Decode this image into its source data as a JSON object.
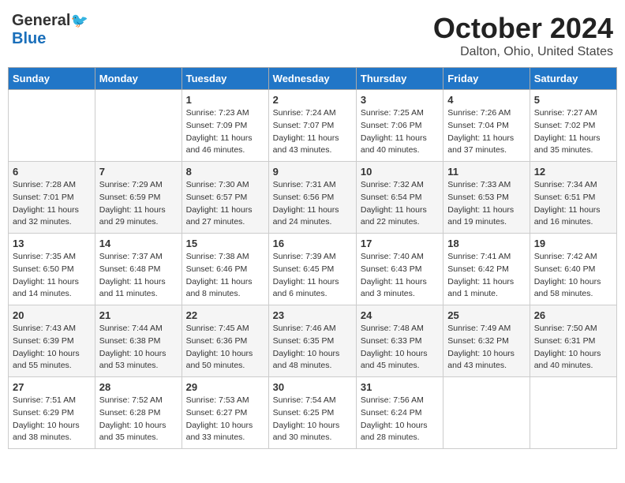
{
  "header": {
    "logo_general": "General",
    "logo_blue": "Blue",
    "month": "October 2024",
    "location": "Dalton, Ohio, United States"
  },
  "days_of_week": [
    "Sunday",
    "Monday",
    "Tuesday",
    "Wednesday",
    "Thursday",
    "Friday",
    "Saturday"
  ],
  "weeks": [
    [
      {
        "day": "",
        "info": ""
      },
      {
        "day": "",
        "info": ""
      },
      {
        "day": "1",
        "info": "Sunrise: 7:23 AM\nSunset: 7:09 PM\nDaylight: 11 hours and 46 minutes."
      },
      {
        "day": "2",
        "info": "Sunrise: 7:24 AM\nSunset: 7:07 PM\nDaylight: 11 hours and 43 minutes."
      },
      {
        "day": "3",
        "info": "Sunrise: 7:25 AM\nSunset: 7:06 PM\nDaylight: 11 hours and 40 minutes."
      },
      {
        "day": "4",
        "info": "Sunrise: 7:26 AM\nSunset: 7:04 PM\nDaylight: 11 hours and 37 minutes."
      },
      {
        "day": "5",
        "info": "Sunrise: 7:27 AM\nSunset: 7:02 PM\nDaylight: 11 hours and 35 minutes."
      }
    ],
    [
      {
        "day": "6",
        "info": "Sunrise: 7:28 AM\nSunset: 7:01 PM\nDaylight: 11 hours and 32 minutes."
      },
      {
        "day": "7",
        "info": "Sunrise: 7:29 AM\nSunset: 6:59 PM\nDaylight: 11 hours and 29 minutes."
      },
      {
        "day": "8",
        "info": "Sunrise: 7:30 AM\nSunset: 6:57 PM\nDaylight: 11 hours and 27 minutes."
      },
      {
        "day": "9",
        "info": "Sunrise: 7:31 AM\nSunset: 6:56 PM\nDaylight: 11 hours and 24 minutes."
      },
      {
        "day": "10",
        "info": "Sunrise: 7:32 AM\nSunset: 6:54 PM\nDaylight: 11 hours and 22 minutes."
      },
      {
        "day": "11",
        "info": "Sunrise: 7:33 AM\nSunset: 6:53 PM\nDaylight: 11 hours and 19 minutes."
      },
      {
        "day": "12",
        "info": "Sunrise: 7:34 AM\nSunset: 6:51 PM\nDaylight: 11 hours and 16 minutes."
      }
    ],
    [
      {
        "day": "13",
        "info": "Sunrise: 7:35 AM\nSunset: 6:50 PM\nDaylight: 11 hours and 14 minutes."
      },
      {
        "day": "14",
        "info": "Sunrise: 7:37 AM\nSunset: 6:48 PM\nDaylight: 11 hours and 11 minutes."
      },
      {
        "day": "15",
        "info": "Sunrise: 7:38 AM\nSunset: 6:46 PM\nDaylight: 11 hours and 8 minutes."
      },
      {
        "day": "16",
        "info": "Sunrise: 7:39 AM\nSunset: 6:45 PM\nDaylight: 11 hours and 6 minutes."
      },
      {
        "day": "17",
        "info": "Sunrise: 7:40 AM\nSunset: 6:43 PM\nDaylight: 11 hours and 3 minutes."
      },
      {
        "day": "18",
        "info": "Sunrise: 7:41 AM\nSunset: 6:42 PM\nDaylight: 11 hours and 1 minute."
      },
      {
        "day": "19",
        "info": "Sunrise: 7:42 AM\nSunset: 6:40 PM\nDaylight: 10 hours and 58 minutes."
      }
    ],
    [
      {
        "day": "20",
        "info": "Sunrise: 7:43 AM\nSunset: 6:39 PM\nDaylight: 10 hours and 55 minutes."
      },
      {
        "day": "21",
        "info": "Sunrise: 7:44 AM\nSunset: 6:38 PM\nDaylight: 10 hours and 53 minutes."
      },
      {
        "day": "22",
        "info": "Sunrise: 7:45 AM\nSunset: 6:36 PM\nDaylight: 10 hours and 50 minutes."
      },
      {
        "day": "23",
        "info": "Sunrise: 7:46 AM\nSunset: 6:35 PM\nDaylight: 10 hours and 48 minutes."
      },
      {
        "day": "24",
        "info": "Sunrise: 7:48 AM\nSunset: 6:33 PM\nDaylight: 10 hours and 45 minutes."
      },
      {
        "day": "25",
        "info": "Sunrise: 7:49 AM\nSunset: 6:32 PM\nDaylight: 10 hours and 43 minutes."
      },
      {
        "day": "26",
        "info": "Sunrise: 7:50 AM\nSunset: 6:31 PM\nDaylight: 10 hours and 40 minutes."
      }
    ],
    [
      {
        "day": "27",
        "info": "Sunrise: 7:51 AM\nSunset: 6:29 PM\nDaylight: 10 hours and 38 minutes."
      },
      {
        "day": "28",
        "info": "Sunrise: 7:52 AM\nSunset: 6:28 PM\nDaylight: 10 hours and 35 minutes."
      },
      {
        "day": "29",
        "info": "Sunrise: 7:53 AM\nSunset: 6:27 PM\nDaylight: 10 hours and 33 minutes."
      },
      {
        "day": "30",
        "info": "Sunrise: 7:54 AM\nSunset: 6:25 PM\nDaylight: 10 hours and 30 minutes."
      },
      {
        "day": "31",
        "info": "Sunrise: 7:56 AM\nSunset: 6:24 PM\nDaylight: 10 hours and 28 minutes."
      },
      {
        "day": "",
        "info": ""
      },
      {
        "day": "",
        "info": ""
      }
    ]
  ]
}
